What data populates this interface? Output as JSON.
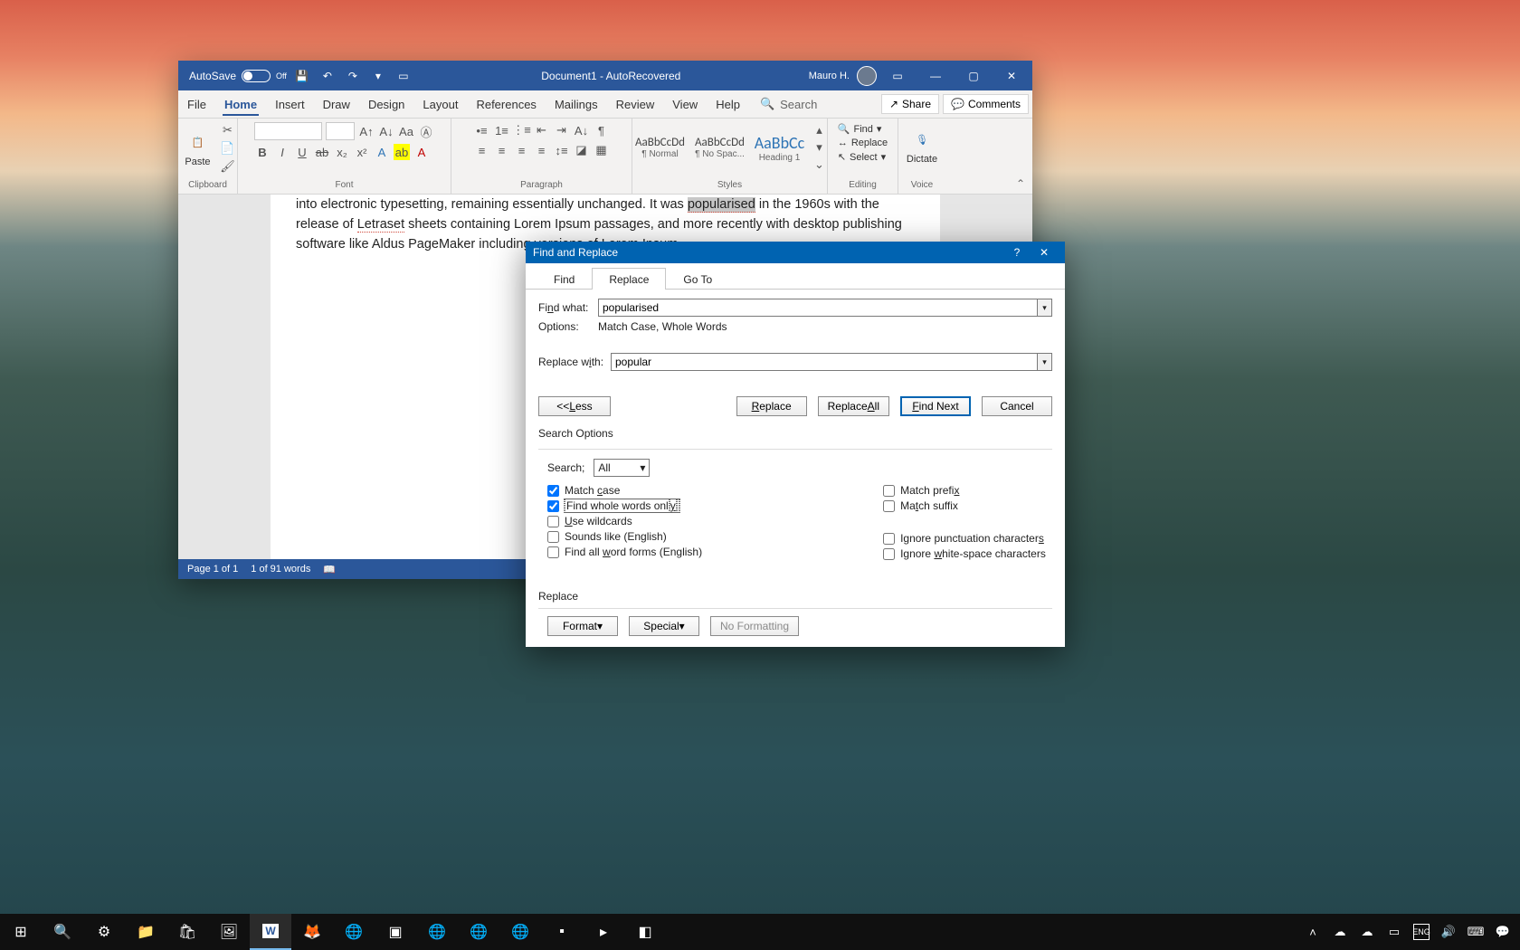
{
  "titlebar": {
    "autosave_label": "AutoSave",
    "autosave_state": "Off",
    "doc_title": "Document1  -  AutoRecovered",
    "user_name": "Mauro H."
  },
  "tabs": {
    "file": "File",
    "home": "Home",
    "insert": "Insert",
    "draw": "Draw",
    "design": "Design",
    "layout": "Layout",
    "references": "References",
    "mailings": "Mailings",
    "review": "Review",
    "view": "View",
    "help": "Help",
    "search_placeholder": "Search",
    "share": "Share",
    "comments": "Comments"
  },
  "ribbon": {
    "clipboard": {
      "paste": "Paste",
      "label": "Clipboard"
    },
    "font": {
      "name_value": "",
      "size_value": "",
      "label": "Font"
    },
    "paragraph": {
      "label": "Paragraph"
    },
    "styles": {
      "label": "Styles",
      "s1_preview": "AaBbCcDd",
      "s1_name": "¶ Normal",
      "s2_preview": "AaBbCcDd",
      "s2_name": "¶ No Spac...",
      "s3_preview": "AaBbCc",
      "s3_name": "Heading 1"
    },
    "editing": {
      "find": "Find",
      "replace": "Replace",
      "select": "Select",
      "label": "Editing"
    },
    "voice": {
      "dictate": "Dictate",
      "label": "Voice"
    }
  },
  "document": {
    "line1a": "into electronic typesetting, remaining essentially unchanged. It was ",
    "line1_hl": "popularised",
    "line1b": " in the 1960s with the",
    "line2a": "release of ",
    "line2_u": "Letraset",
    "line2b": " sheets containing Lorem Ipsum passages, and more recently with desktop publishing",
    "line3": "software like Aldus PageMaker including versions of Lorem Ipsum."
  },
  "statusbar": {
    "page": "Page 1 of 1",
    "words": "1 of 91 words"
  },
  "dialog": {
    "title": "Find and Replace",
    "tabs": {
      "find": "Find",
      "replace": "Replace",
      "goto": "Go To"
    },
    "find_label_pre": "Fi",
    "find_label_ul": "n",
    "find_label_post": "d what:",
    "find_value": "popularised",
    "options_label": "Options:",
    "options_value": "Match Case, Whole Words",
    "replace_label_pre": "Replace w",
    "replace_label_ul": "i",
    "replace_label_post": "th:",
    "replace_value": "popular",
    "btn_less_pre": "<< ",
    "btn_less_ul": "L",
    "btn_less_post": "ess",
    "btn_replace_pre": "",
    "btn_replace_ul": "R",
    "btn_replace_post": "eplace",
    "btn_replace_all_pre": "Replace ",
    "btn_replace_all_ul": "A",
    "btn_replace_all_post": "ll",
    "btn_findnext_pre": "",
    "btn_findnext_ul": "F",
    "btn_findnext_post": "ind Next",
    "btn_cancel": "Cancel",
    "search_options_label": "Search Options",
    "search_dir_label": "Search;",
    "search_dir_value": "All",
    "chk_match_case_pre": "Match ",
    "chk_match_case_ul": "c",
    "chk_match_case_post": "ase",
    "chk_whole_words_pre": "Find whole words onl",
    "chk_whole_words_ul": "y",
    "chk_whole_words_post": "",
    "chk_wildcards_pre": "",
    "chk_wildcards_ul": "U",
    "chk_wildcards_post": "se wildcards",
    "chk_sounds_like": "Sounds like (English)",
    "chk_word_forms_pre": "Find all ",
    "chk_word_forms_ul": "w",
    "chk_word_forms_post": "ord forms (English)",
    "chk_prefix_pre": "Match prefi",
    "chk_prefix_ul": "x",
    "chk_prefix_post": "",
    "chk_suffix_pre": "Ma",
    "chk_suffix_ul": "t",
    "chk_suffix_post": "ch suffix",
    "chk_ignore_punct_pre": "Ignore punctuation character",
    "chk_ignore_punct_ul": "s",
    "chk_ignore_punct_post": "",
    "chk_ignore_ws_pre": "Ignore ",
    "chk_ignore_ws_ul": "w",
    "chk_ignore_ws_post": "hite-space characters",
    "replace_section_label": "Replace",
    "btn_format": "Format",
    "btn_special": "Special",
    "btn_noformat": "No Formatting"
  },
  "taskbar": {
    "time": "",
    "date": ""
  }
}
